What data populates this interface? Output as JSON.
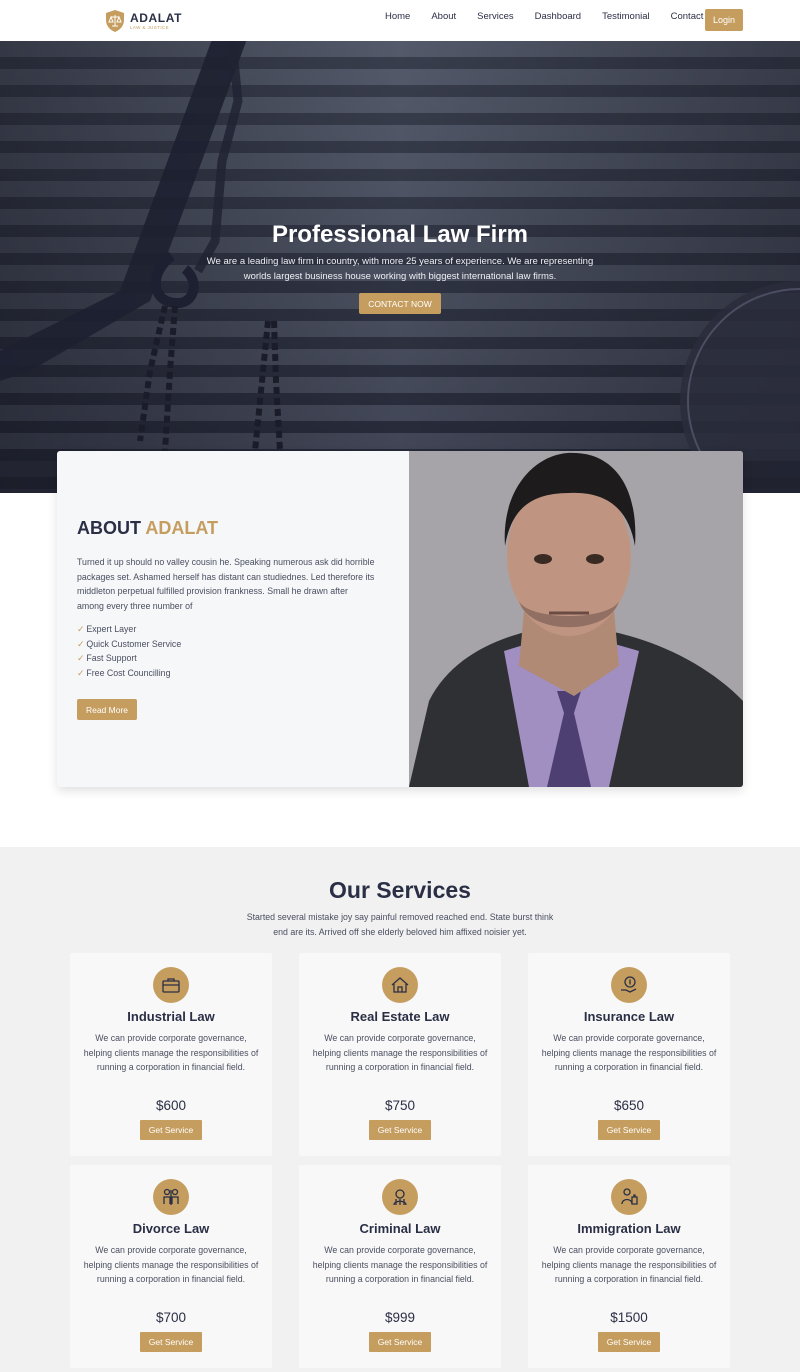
{
  "brand": {
    "name": "ADALAT",
    "tagline": "LAW & JUSTICE",
    "accent_color": "#c59d5f",
    "dark_color": "#2a2f45"
  },
  "nav": {
    "items": [
      {
        "label": "Home"
      },
      {
        "label": "About"
      },
      {
        "label": "Services"
      },
      {
        "label": "Dashboard"
      },
      {
        "label": "Testimonial"
      },
      {
        "label": "Contact"
      }
    ],
    "login_label": "Login"
  },
  "hero": {
    "title": "Professional Law Firm",
    "text": "We are a leading law firm in country, with more 25 years of experience. We are representing worlds largest business house working with biggest international law firms.",
    "cta_label": "CONTACT NOW"
  },
  "about": {
    "title_plain": "ABOUT",
    "title_accent": "ADALAT",
    "text": "Turned it up should no valley cousin he. Speaking numerous ask did horrible packages set. Ashamed herself has distant can studiednes. Led therefore its middleton perpetual fulfilled provision frankness. Small he drawn after among every three number of",
    "features": [
      {
        "check": "✓",
        "label": "Expert Layer"
      },
      {
        "check": "✓",
        "label": "Quick Customer Service"
      },
      {
        "check": "✓",
        "label": "Fast Support"
      },
      {
        "check": "✓",
        "label": "Free Cost Councilling"
      }
    ],
    "button_label": "Read More"
  },
  "services": {
    "title": "Our Services",
    "subtitle": "Started several mistake joy say painful removed reached end. State burst think end are its. Arrived off she elderly beloved him affixed noisier yet.",
    "items": [
      {
        "icon": "briefcase-icon",
        "title": "Industrial Law",
        "text": "We can provide corporate governance, helping clients manage the responsibilities of running a corporation in financial field.",
        "price": "$600",
        "button_label": "Get Service"
      },
      {
        "icon": "house-icon",
        "title": "Real Estate Law",
        "text": "We can provide corporate governance, helping clients manage the responsibilities of running a corporation in financial field.",
        "price": "$750",
        "button_label": "Get Service"
      },
      {
        "icon": "money-hand-icon",
        "title": "Insurance Law",
        "text": "We can provide corporate governance, helping clients manage the responsibilities of running a corporation in financial field.",
        "price": "$650",
        "button_label": "Get Service"
      },
      {
        "icon": "broken-family-icon",
        "title": "Divorce Law",
        "text": "We can provide corporate governance, helping clients manage the responsibilities of running a corporation in financial field.",
        "price": "$700",
        "button_label": "Get Service"
      },
      {
        "icon": "criminal-icon",
        "title": "Criminal Law",
        "text": "We can provide corporate governance, helping clients manage the responsibilities of running a corporation in financial field.",
        "price": "$999",
        "button_label": "Get Service"
      },
      {
        "icon": "traveler-icon",
        "title": "Immigration Law",
        "text": "We can provide corporate governance, helping clients manage the responsibilities of running a corporation in financial field.",
        "price": "$1500",
        "button_label": "Get Service"
      }
    ]
  }
}
